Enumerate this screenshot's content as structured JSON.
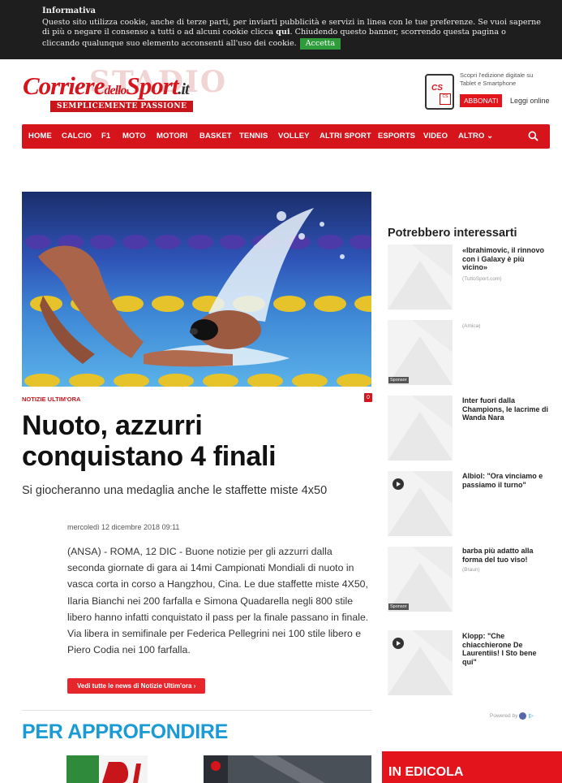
{
  "cookie": {
    "title": "Informativa",
    "line1": "Questo sito utilizza cookie, anche di terze parti, per inviarti pubblicità e servizi in linea con le tue preferenze. Se vuoi saperne",
    "line2_pre": "di più o negare il consenso a tutti o ad alcuni cookie clicca ",
    "line2_link": "qui",
    "line2_post": ". Chiudendo questo banner, scorrendo questa pagina o",
    "line3": "cliccando qualunque suo elemento acconsenti all'uso dei cookie.",
    "accept_label": "Accetta"
  },
  "header": {
    "logo_main": "Corriere",
    "logo_dello": "dello",
    "logo_sport": "Sport",
    "logo_it": ".it",
    "logo_bg": "STADIO",
    "tagline": "SEMPLICEMENTE PASSIONE",
    "tablet_cs": "CS",
    "tablet_sub": "CS",
    "digital_text": "Scopri l'edizione digitale su Tablet e Smartphone",
    "abbonati_label": "ABBONATI",
    "leggi_label": "Leggi online"
  },
  "nav": {
    "items": [
      "HOME",
      "CALCIO",
      "F1",
      "MOTO",
      "MOTORI",
      "BASKET",
      "TENNIS",
      "VOLLEY",
      "ALTRI SPORT",
      "ESPORTS",
      "VIDEO",
      "ALTRO ⌄"
    ]
  },
  "article": {
    "category": "NOTIZIE ULTIM'ORA",
    "comment_count": "0",
    "headline": "Nuoto, azzurri conquistano 4 finali",
    "subhead": "Si giocheranno una medaglia anche le staffette miste 4x50",
    "date": "mercoledì 12 dicembre 2018 09:11",
    "body": "(ANSA) - ROMA, 12 DIC - Buone notizie per gli azzurri dalla seconda giornate di gara ai 14mi Campionati Mondiali di nuoto in vasca corta in corso a Hangzhou, Cina. Le due staffette miste 4X50, Ilaria Bianchi nei 200 farfalla e Simona Quadarella negli 800 stile libero hanno infatti conquistato il pass per la finale passano in finale. Via libera in semifinale per Federica Pellegrini nei 100 stile libero e Piero Codia nei 100 farfalla.",
    "more_label": "Vedi tutte le news di Notizie Ultim'ora  ›",
    "section_title": "PER APPROFONDIRE"
  },
  "sidebar": {
    "title": "Potrebbero interessarti",
    "cards": [
      {
        "title": "«Ibrahimovic, il rinnovo con i Galaxy è più vicino»",
        "source": "(TuttoSport.com)",
        "tag": "",
        "video": false
      },
      {
        "title": "",
        "source": "(Amica)",
        "tag": "Sponsor",
        "video": false
      },
      {
        "title": "Inter fuori dalla Champions, le lacrime di Wanda Nara",
        "source": "",
        "tag": "",
        "video": false
      },
      {
        "title": "Albiol: \"Ora vinciamo e passiamo il turno\"",
        "source": "",
        "tag": "",
        "video": true
      },
      {
        "title": "barba più adatto alla forma del tuo viso!",
        "source": "(Braun)",
        "tag": "Sponsor",
        "video": false
      },
      {
        "title": "Klopp: \"Che chiacchierone De Laurentiis! I Sto bene qui\"",
        "source": "",
        "tag": "",
        "video": true
      }
    ],
    "powered_by": "Powered by",
    "edicola_label": "IN EDICOLA"
  }
}
